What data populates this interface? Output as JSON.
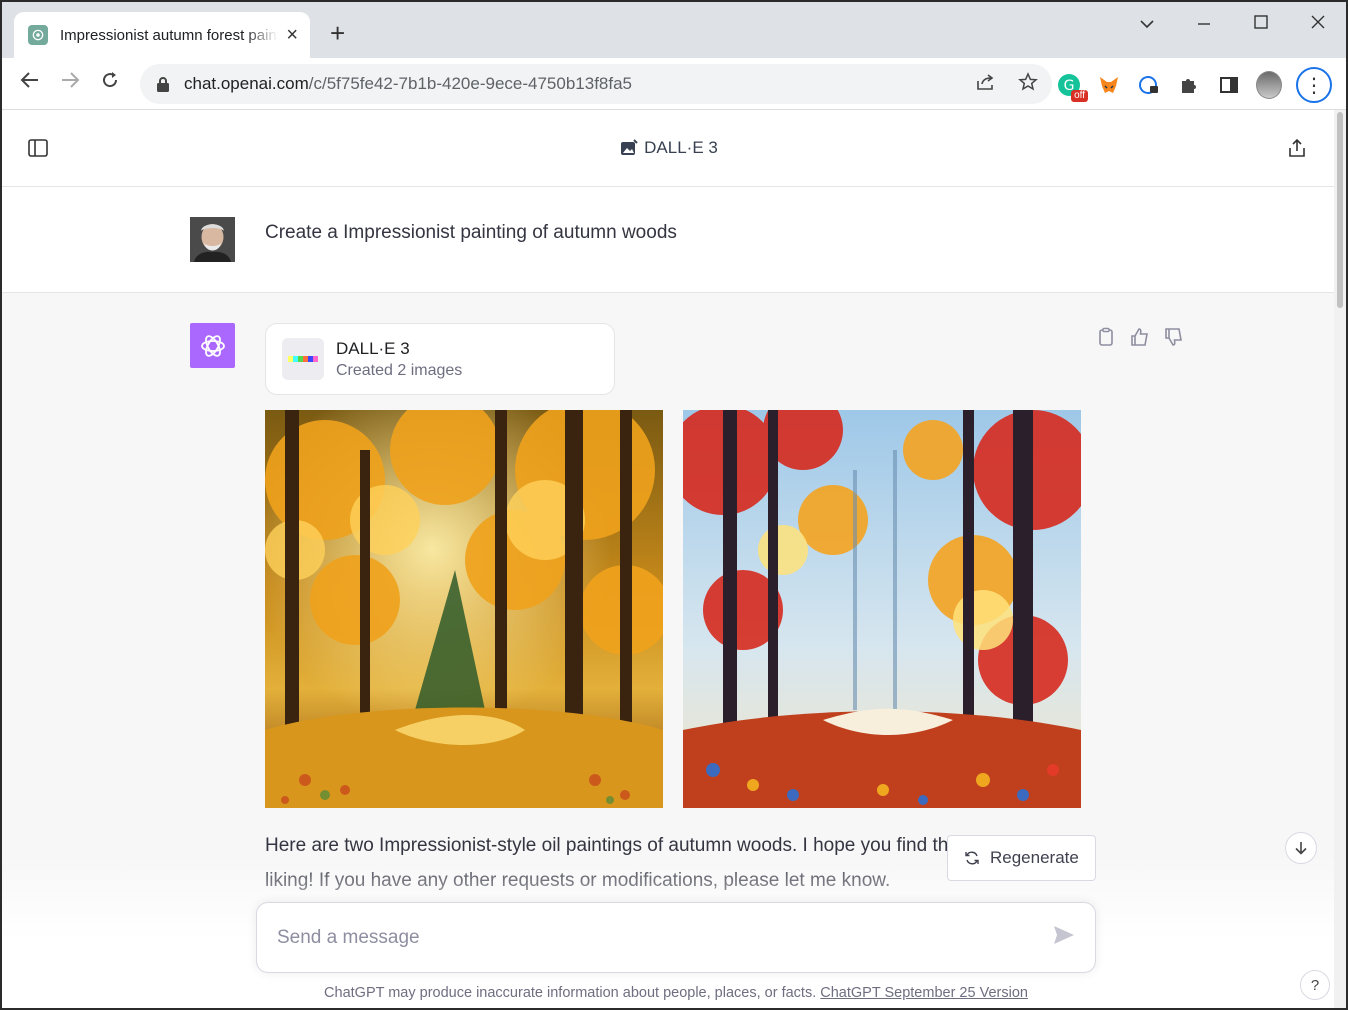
{
  "browser": {
    "tab_title": "Impressionist autumn forest painting",
    "tab_favicon": "chatgpt-favicon-icon",
    "url_host": "chat.openai.com",
    "url_path": "/c/5f75fe42-7b1b-420e-9ece-4750b13f8fa5",
    "extension_badge": "off"
  },
  "header": {
    "model_name": "DALL·E 3"
  },
  "conversation": {
    "user_prompt": "Create a Impressionist painting of autumn woods",
    "tool_card": {
      "title": "DALL·E 3",
      "subtitle": "Created 2 images"
    },
    "response": "Here are two Impressionist-style oil paintings of autumn woods. I hope you find them to your liking! If you have any other requests or modifications, please let me know."
  },
  "controls": {
    "regenerate_label": "Regenerate",
    "composer_placeholder": "Send a message"
  },
  "footer": {
    "disclaimer": "ChatGPT may produce inaccurate information about people, places, or facts.",
    "version_link": "ChatGPT September 25 Version",
    "help_label": "?"
  },
  "colors": {
    "assistant_avatar": "#ab68ff",
    "tab_favicon": "#74aa9c",
    "focus_ring": "#1a73e8"
  }
}
